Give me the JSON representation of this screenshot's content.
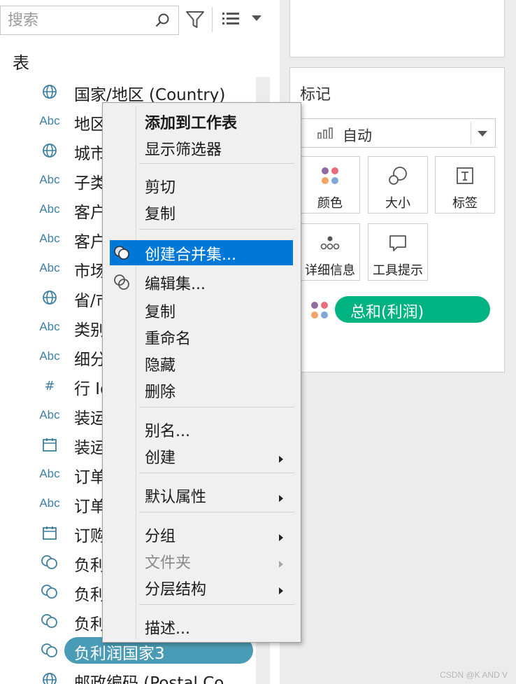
{
  "search": {
    "placeholder": "搜索"
  },
  "data_pane": {
    "section_title": "表",
    "fields": [
      {
        "type_icon": "globe-icon",
        "type_text": "",
        "name": "国家/地区 (Country)"
      },
      {
        "type_icon": "abc-icon",
        "type_text": "Abc",
        "name": "地区"
      },
      {
        "type_icon": "globe-icon",
        "type_text": "",
        "name": "城市"
      },
      {
        "type_icon": "abc-icon",
        "type_text": "Abc",
        "name": "子类"
      },
      {
        "type_icon": "abc-icon",
        "type_text": "Abc",
        "name": "客户"
      },
      {
        "type_icon": "abc-icon",
        "type_text": "Abc",
        "name": "客户"
      },
      {
        "type_icon": "abc-icon",
        "type_text": "Abc",
        "name": "市场"
      },
      {
        "type_icon": "globe-icon",
        "type_text": "",
        "name": "省/市"
      },
      {
        "type_icon": "abc-icon",
        "type_text": "Abc",
        "name": "类别"
      },
      {
        "type_icon": "abc-icon",
        "type_text": "Abc",
        "name": "细分"
      },
      {
        "type_icon": "hash-icon",
        "type_text": "#",
        "name": "行 Id"
      },
      {
        "type_icon": "abc-icon",
        "type_text": "Abc",
        "name": "装运"
      },
      {
        "type_icon": "calendar-icon",
        "type_text": "",
        "name": "装运"
      },
      {
        "type_icon": "abc-icon",
        "type_text": "Abc",
        "name": "订单"
      },
      {
        "type_icon": "abc-icon",
        "type_text": "Abc",
        "name": "订单"
      },
      {
        "type_icon": "calendar-icon",
        "type_text": "",
        "name": "订购"
      },
      {
        "type_icon": "set-icon",
        "type_text": "",
        "name": "负利"
      },
      {
        "type_icon": "set-icon",
        "type_text": "",
        "name": "负利"
      },
      {
        "type_icon": "set-icon",
        "type_text": "",
        "name": "负利"
      },
      {
        "type_icon": "set-icon",
        "type_text": "",
        "name": "负利润国家3",
        "selected": true
      },
      {
        "type_icon": "globe-icon",
        "type_text": "",
        "name": "邮政编码 (Postal Co"
      }
    ]
  },
  "marks": {
    "title": "标记",
    "mark_type": "自动",
    "buttons": [
      {
        "id": "color",
        "icon": "color-dots-icon",
        "label": "颜色"
      },
      {
        "id": "size",
        "icon": "size-circles-icon",
        "label": "大小"
      },
      {
        "id": "label",
        "icon": "text-label-icon",
        "label": "标签"
      },
      {
        "id": "detail",
        "icon": "detail-dots-icon",
        "label": "详细信息"
      },
      {
        "id": "tooltip",
        "icon": "speech-bubble-icon",
        "label": "工具提示"
      }
    ],
    "pill": "总和(利润)",
    "pill_color": "#00b380"
  },
  "context_menu": {
    "items": [
      {
        "label": "添加到工作表",
        "bold": true
      },
      {
        "label": "显示筛选器"
      },
      {
        "label": "剪切"
      },
      {
        "label": "复制"
      },
      {
        "label": "创建合并集...",
        "icon": "combined-set-icon",
        "highlighted": true
      },
      {
        "label": "编辑集...",
        "icon": "set-icon"
      },
      {
        "label": "复制"
      },
      {
        "label": "重命名"
      },
      {
        "label": "隐藏"
      },
      {
        "label": "删除"
      },
      {
        "label": "别名..."
      },
      {
        "label": "创建",
        "submenu": true
      },
      {
        "label": "默认属性",
        "submenu": true
      },
      {
        "label": "分组",
        "submenu": true
      },
      {
        "label": "文件夹",
        "submenu": true,
        "disabled": true
      },
      {
        "label": "分层结构",
        "submenu": true
      },
      {
        "label": "描述..."
      }
    ]
  },
  "colors": {
    "accent_blue": "#0078d7",
    "selected_field": "#4a9bb5",
    "field_icon": "#3d7fa0"
  },
  "watermark": "CSDN @K AND V"
}
